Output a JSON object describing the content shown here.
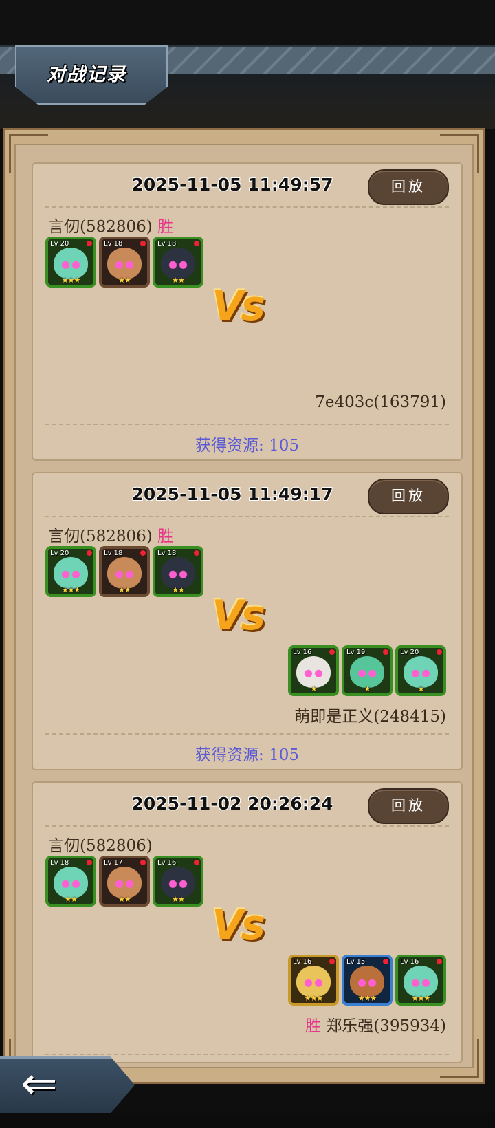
{
  "header": {
    "title": "对战记录"
  },
  "records": [
    {
      "timestamp": "2025-11-05  11:49:57",
      "replay_label": "回放",
      "player1": {
        "name": "言仞(582806)",
        "result": "胜",
        "heroes": [
          {
            "level": "Lv 20",
            "stars": "★★★",
            "frame": "green",
            "face": "#6fd3b6"
          },
          {
            "level": "Lv 18",
            "stars": "★★",
            "frame": "brown",
            "face": "#c98a5a"
          },
          {
            "level": "Lv 18",
            "stars": "★★",
            "frame": "green",
            "face": "#2d3240"
          }
        ]
      },
      "vs": "Vs",
      "player2": {
        "name": "7e403c(163791)",
        "result": "",
        "heroes": []
      },
      "reward": "获得资源: 105"
    },
    {
      "timestamp": "2025-11-05  11:49:17",
      "replay_label": "回放",
      "player1": {
        "name": "言仞(582806)",
        "result": "胜",
        "heroes": [
          {
            "level": "Lv 20",
            "stars": "★★★",
            "frame": "green",
            "face": "#6fd3b6"
          },
          {
            "level": "Lv 18",
            "stars": "★★",
            "frame": "brown",
            "face": "#c98a5a"
          },
          {
            "level": "Lv 18",
            "stars": "★★",
            "frame": "green",
            "face": "#2d3240"
          }
        ]
      },
      "vs": "Vs",
      "player2": {
        "name": "萌即是正义(248415)",
        "result": "",
        "heroes": [
          {
            "level": "Lv 16",
            "stars": "★",
            "frame": "green",
            "face": "#e8e4e0"
          },
          {
            "level": "Lv 19",
            "stars": "★",
            "frame": "green",
            "face": "#57c59a"
          },
          {
            "level": "Lv 20",
            "stars": "★",
            "frame": "green",
            "face": "#6fd3b6"
          }
        ]
      },
      "reward": "获得资源: 105"
    },
    {
      "timestamp": "2025-11-02  20:26:24",
      "replay_label": "回放",
      "player1": {
        "name": "言仞(582806)",
        "result": "",
        "heroes": [
          {
            "level": "Lv 18",
            "stars": "★★",
            "frame": "green",
            "face": "#6fd3b6"
          },
          {
            "level": "Lv 17",
            "stars": "★★",
            "frame": "brown",
            "face": "#c98a5a"
          },
          {
            "level": "Lv 16",
            "stars": "★★",
            "frame": "green",
            "face": "#2d3240"
          }
        ]
      },
      "vs": "Vs",
      "player2": {
        "name": "郑乐强(395934)",
        "result": "胜",
        "heroes": [
          {
            "level": "Lv 16",
            "stars": "★★★",
            "frame": "gold",
            "face": "#e9c45a"
          },
          {
            "level": "Lv 15",
            "stars": "★★★",
            "frame": "blue",
            "face": "#b9703a"
          },
          {
            "level": "Lv 16",
            "stars": "★★★",
            "frame": "green",
            "face": "#6fd3b6"
          }
        ]
      },
      "reward": ""
    }
  ],
  "back_button": {
    "icon": "back-arrow-icon",
    "glyph": "⇐"
  }
}
